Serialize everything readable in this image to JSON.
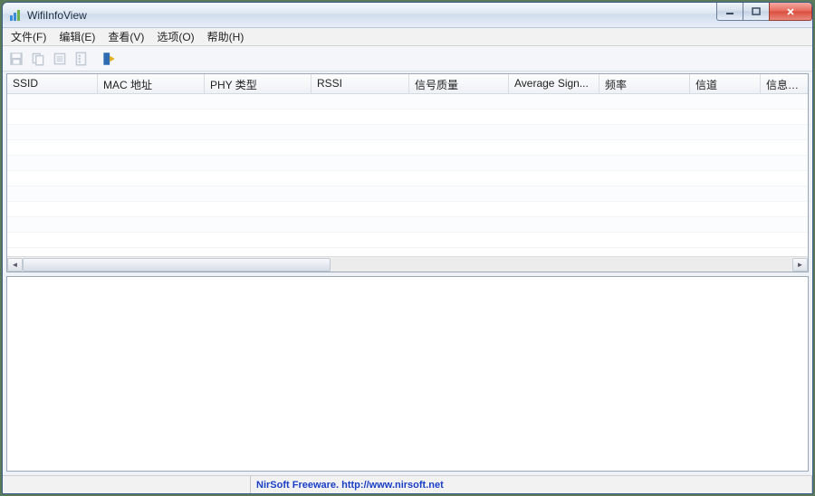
{
  "window": {
    "title": "WifiInfoView"
  },
  "menu": {
    "file": "文件(F)",
    "edit": "编辑(E)",
    "view": "查看(V)",
    "options": "选项(O)",
    "help": "帮助(H)"
  },
  "columns": {
    "c0": "SSID",
    "c1": "MAC 地址",
    "c2": "PHY 类型",
    "c3": "RSSI",
    "c4": "信号质量",
    "c5": "Average Sign...",
    "c6": "频率",
    "c7": "信道",
    "c8": "信息大小"
  },
  "status": {
    "text": "NirSoft Freeware.  http://www.nirsoft.net"
  }
}
